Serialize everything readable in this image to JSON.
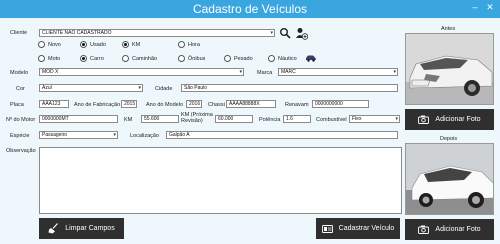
{
  "window": {
    "title": "Cadastro de Veículos",
    "minimize": "–",
    "close": "✕"
  },
  "cliente": {
    "label": "Cliente",
    "value": "CLIENTE NÃO CADASTRADO"
  },
  "condition": {
    "novo": "Novo",
    "usado": "Usado",
    "selected": "usado"
  },
  "unit": {
    "km": "KM",
    "hora": "Hora",
    "selected": "km"
  },
  "vehicle_type": {
    "options": [
      "Moto",
      "Carro",
      "Caminhão",
      "Ônibus",
      "Pesado",
      "Náutico"
    ],
    "selected": "Carro"
  },
  "modelo": {
    "label": "Modelo",
    "value": "MOD X"
  },
  "marca": {
    "label": "Marca",
    "value": "MARC"
  },
  "cor": {
    "label": "Cor",
    "value": "Azul"
  },
  "cidade": {
    "label": "Cidade",
    "value": "São Paulo"
  },
  "placa": {
    "label": "Placa",
    "value": "AAA123"
  },
  "ano_fabricacao": {
    "label": "Ano de Fabricação",
    "value": "2015"
  },
  "ano_modelo": {
    "label": "Ano do Modelo",
    "value": "2016"
  },
  "chassi": {
    "label": "Chassi",
    "value": "AAAA88888X"
  },
  "renavam": {
    "label": "Renavam",
    "value": "0000000000"
  },
  "motor": {
    "label": "Nº do Motor",
    "value": "0000000MT"
  },
  "km": {
    "label": "KM",
    "value": "55.600"
  },
  "km_revisao": {
    "label_1": "KM (Próxima",
    "label_2": "Revisão)",
    "value": "60.000"
  },
  "potencia": {
    "label": "Potência",
    "value": "1.6"
  },
  "combustivel": {
    "label": "Combustível",
    "value": "Flex"
  },
  "especie": {
    "label": "Espécie",
    "value": "Passageiro"
  },
  "localizacao": {
    "label": "Localização",
    "value": "Galpão A"
  },
  "observacao": {
    "label": "Observação",
    "value": ""
  },
  "photos": {
    "antes": "Antes",
    "depois": "Depois",
    "add_label": "Adicionar Foto"
  },
  "buttons": {
    "limpar": "Limpar Campos",
    "cadastrar": "Cadastrar Veículo"
  },
  "colors": {
    "titlebar": "#3aa6e0",
    "background": "#eef8fc",
    "button": "#2f2f2f"
  },
  "icons": [
    "search-icon",
    "add-user-icon",
    "car-icon",
    "camera-icon",
    "broom-icon",
    "id-card-icon",
    "minimize-icon",
    "close-icon"
  ]
}
